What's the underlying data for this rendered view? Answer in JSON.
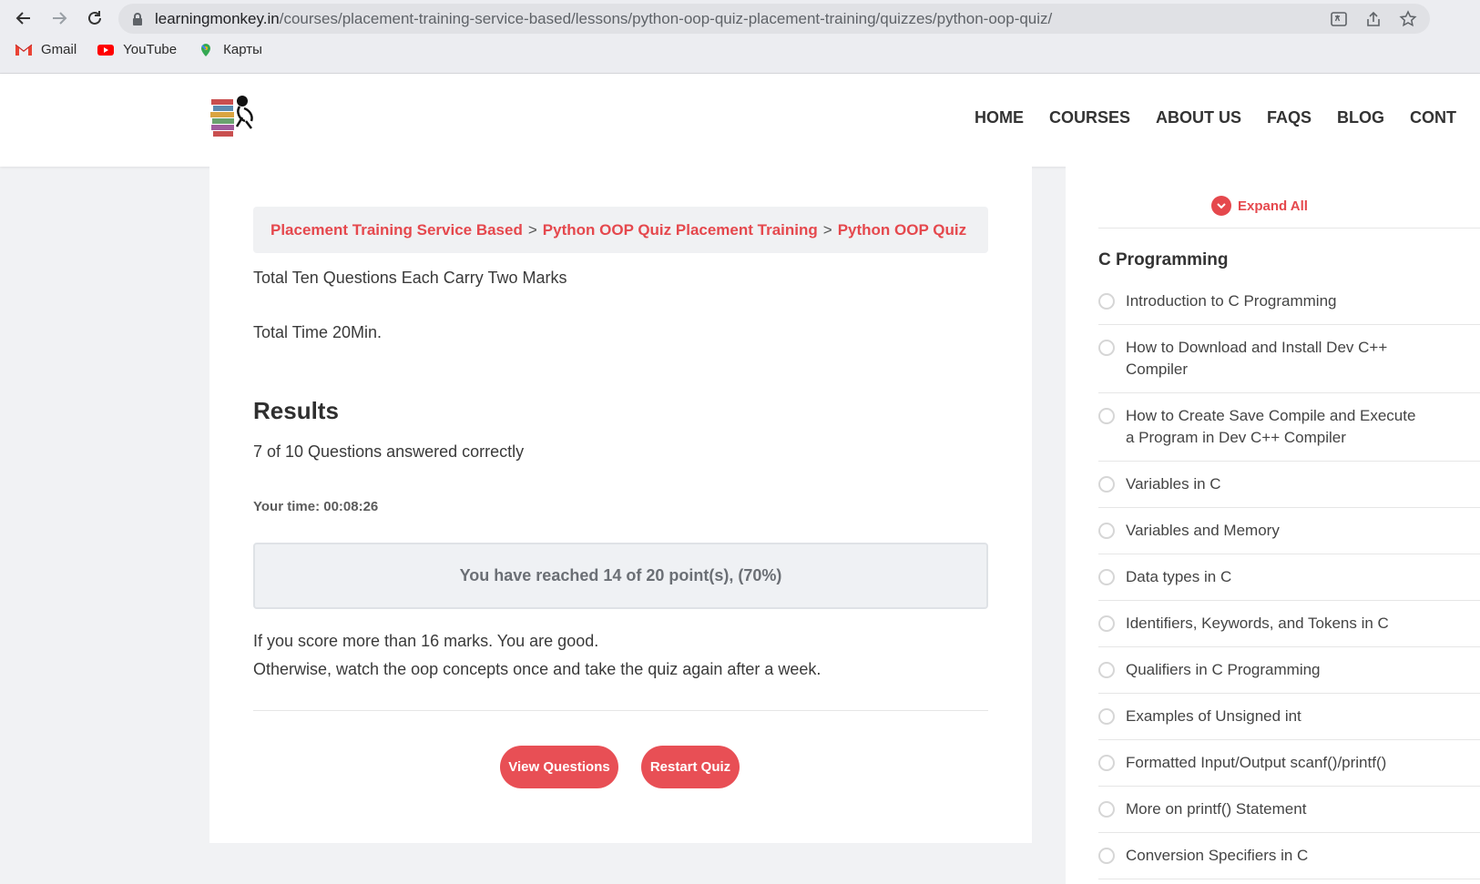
{
  "browser": {
    "url_host": "learningmonkey.in",
    "url_path": "/courses/placement-training-service-based/lessons/python-oop-quiz-placement-training/quizzes/python-oop-quiz/",
    "bookmarks": [
      {
        "label": "Gmail",
        "icon": "gmail-icon"
      },
      {
        "label": "YouTube",
        "icon": "youtube-icon"
      },
      {
        "label": "Карты",
        "icon": "maps-icon"
      }
    ]
  },
  "nav": {
    "items": [
      "HOME",
      "COURSES",
      "ABOUT US",
      "FAQS",
      "BLOG",
      "CONT"
    ]
  },
  "breadcrumb": {
    "items": [
      "Placement Training Service Based",
      "Python OOP Quiz Placement Training",
      "Python OOP Quiz"
    ],
    "separator": ">"
  },
  "quiz": {
    "intro_1": "Total Ten Questions Each Carry Two Marks",
    "intro_2": "Total Time 20Min.",
    "results_heading": "Results",
    "answered": "7 of 10 Questions answered correctly",
    "your_time": "Your time: 00:08:26",
    "points": "You have reached 14 of 20 point(s), (70%)",
    "advice_1": "If you score more than 16 marks. You are good.",
    "advice_2": "Otherwise, watch the oop concepts once and take the quiz again after a week.",
    "view_questions_label": "View Questions",
    "restart_label": "Restart Quiz"
  },
  "sidebar": {
    "expand_label": "Expand All",
    "section_title": "C Programming",
    "lessons": [
      "Introduction to C Programming",
      "How to Download and Install Dev C++ Compiler",
      "How to Create Save Compile and Execute a Program in Dev C++ Compiler",
      "Variables in C",
      "Variables and Memory",
      "Data types in C",
      "Identifiers, Keywords, and Tokens in C",
      "Qualifiers in C Programming",
      "Examples of Unsigned int",
      "Formatted Input/Output scanf()/printf()",
      "More on printf() Statement",
      "Conversion Specifiers in C"
    ]
  },
  "colors": {
    "accent": "#e5484d",
    "button": "#e84f55"
  }
}
